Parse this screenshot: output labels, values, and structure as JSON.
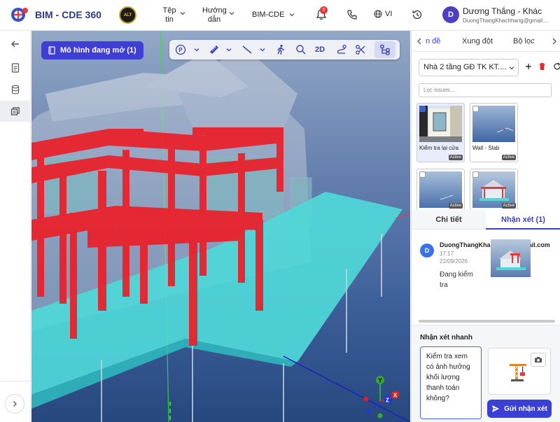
{
  "app": {
    "title": "BIM - CDE 360",
    "badge_text": "ALT"
  },
  "header": {
    "menu_file": "Tệp tin",
    "menu_help": "Hướng dẫn",
    "menu_bim": "BIM-CDE",
    "notification_count": "5",
    "language": "VI",
    "user_initial": "D",
    "user_name": "Dương Thắng - Khác",
    "user_email": "DuongThangKhachhang@gmail...."
  },
  "viewport": {
    "open_models_label": "Mô hình đang mở (1)",
    "toolbar": {
      "view_2d": "2D"
    },
    "axes": {
      "x": "X",
      "y": "Y",
      "z": "Z"
    }
  },
  "right_panel": {
    "tabs": [
      "n đề",
      "Xung đột",
      "Bộ lọc"
    ],
    "active_tab": 0,
    "model_select": "Nhà 2 tầng GĐ TK KT....",
    "filter_placeholder": "Lọc issues...",
    "issues": [
      {
        "title": "Kiểm tra lại cửa",
        "status": "Active",
        "checked": true
      },
      {
        "title": "Wall - Slab",
        "status": "Active",
        "checked": false
      },
      {
        "title": "",
        "status": "Active",
        "checked": false
      },
      {
        "title": "",
        "status": "Active",
        "checked": false
      }
    ],
    "sub_tabs": {
      "detail": "Chi tiết",
      "comments": "Nhận xét (1)"
    },
    "comment": {
      "initial": "D",
      "author": "DuongThangKhachhang@gmail.com",
      "time": "17:17",
      "date": "22/09/2026",
      "text": "Đang kiểm tra"
    },
    "quick": {
      "title": "Nhận xét nhanh",
      "text": "Kiểm tra xem có ảnh hưởng khối lượng thanh toán không?",
      "send_label": "Gửi nhận xét"
    }
  },
  "colors": {
    "brand": "#2d3a8c",
    "accent": "#3a3fd6",
    "structure_red": "#ee1c25",
    "slab_cyan": "#4fd8d8"
  }
}
